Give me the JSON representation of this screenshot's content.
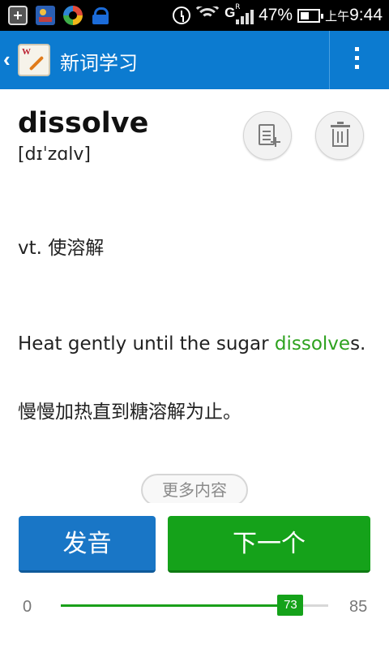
{
  "status_bar": {
    "battery_percent": "47%",
    "time_prefix": "上午",
    "time": "9:44",
    "network_type": "G",
    "roaming_indicator": "R",
    "icons": [
      "add-box-icon",
      "photo-card-icon",
      "colorful-ring-icon",
      "blue-lock-icon",
      "alarm-icon",
      "wifi-icon",
      "signal-icon",
      "battery-icon"
    ]
  },
  "appbar": {
    "title": "新词学习",
    "back_glyph": "‹",
    "color": "#0c7bd0"
  },
  "word": {
    "text": "dissolve",
    "phonetic": "[dɪˈzɑlv]"
  },
  "definition": {
    "text": "vt. 使溶解"
  },
  "example": {
    "en_before": "Heat gently until the sugar ",
    "en_highlight": "dissolve",
    "en_after": "s.",
    "cn": "慢慢加热直到糖溶解为止。",
    "highlight_color": "#2ea21f"
  },
  "more_button": {
    "label": "更多内容"
  },
  "buttons": {
    "pronounce": "发音",
    "next": "下一个",
    "pronounce_color": "#1976c6",
    "next_color": "#15a21a"
  },
  "progress": {
    "min": "0",
    "max": "85",
    "current": "73",
    "current_value": 73,
    "max_value": 85
  }
}
